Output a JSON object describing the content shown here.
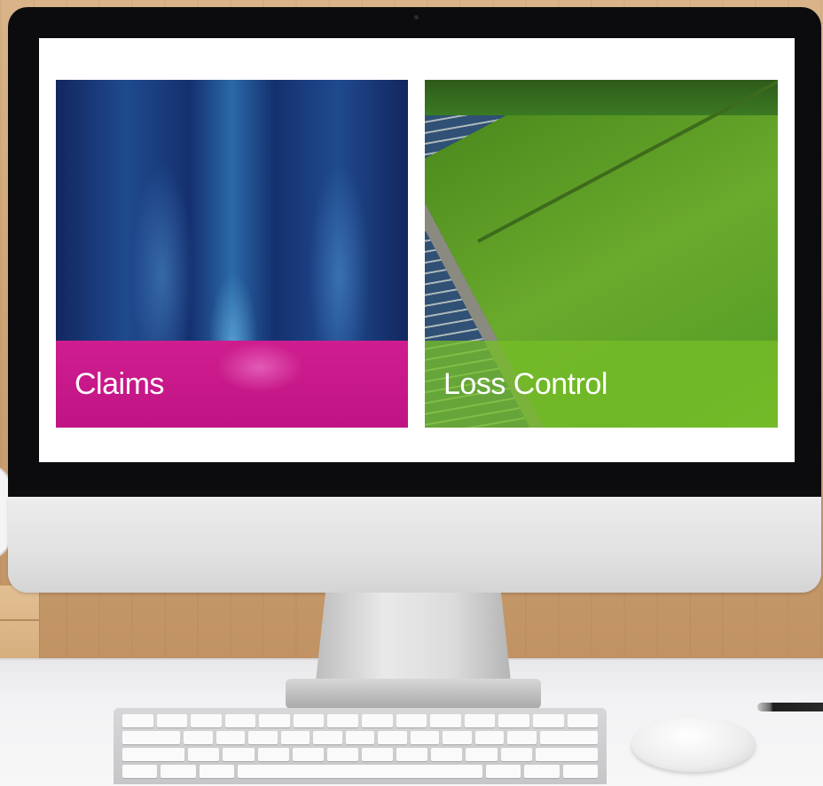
{
  "screen": {
    "tiles": [
      {
        "label": "Claims"
      },
      {
        "label": "Loss Control"
      }
    ]
  },
  "colors": {
    "claims_bar": "#c01484",
    "loss_control_bar": "#76be28",
    "screen_background": "#ffffff",
    "bezel": "#0c0c0e"
  },
  "icons": [
    "clock-icon",
    "camera-dot-icon"
  ]
}
